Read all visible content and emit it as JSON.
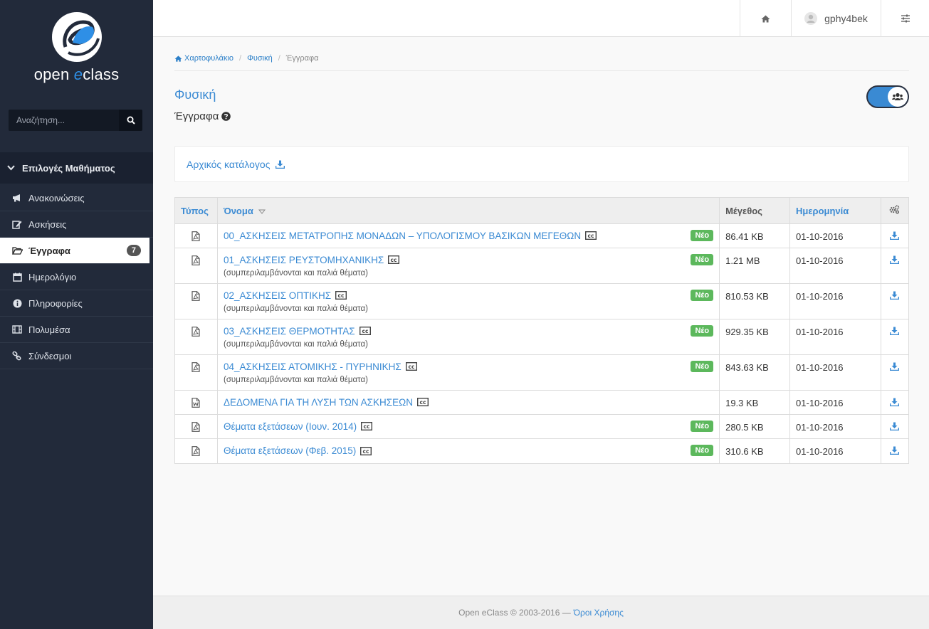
{
  "sidebar": {
    "logo": {
      "word1": "open ",
      "word2": "e",
      "word3": "class"
    },
    "search": {
      "placeholder": "Αναζήτηση..."
    },
    "menu_header": "Επιλογές Μαθήματος",
    "items": [
      {
        "label": "Ανακοινώσεις",
        "icon": "megaphone-icon"
      },
      {
        "label": "Ασκήσεις",
        "icon": "edit-icon"
      },
      {
        "label": "Έγγραφα",
        "icon": "folder-open-icon",
        "badge": "7",
        "active": true
      },
      {
        "label": "Ημερολόγιο",
        "icon": "calendar-icon"
      },
      {
        "label": "Πληροφορίες",
        "icon": "info-icon"
      },
      {
        "label": "Πολυμέσα",
        "icon": "film-icon"
      },
      {
        "label": "Σύνδεσμοι",
        "icon": "link-icon"
      }
    ]
  },
  "topbar": {
    "username": "gphy4bek"
  },
  "breadcrumb": [
    "Χαρτοφυλάκιο",
    "Φυσική",
    "Έγγραφα"
  ],
  "course_title": "Φυσική",
  "section_title": "Έγγραφα",
  "root_dir": "Αρχικός κατάλογος",
  "table": {
    "headers": {
      "type": "Τύπος",
      "name": "Όνομα",
      "size": "Μέγεθος",
      "date": "Ημερομηνία"
    },
    "new_label": "Νέο",
    "rows": [
      {
        "type": "pdf",
        "name": "00_ΑΣΚΗΣΕΙΣ ΜΕΤΑΤΡΟΠΗΣ ΜΟΝΑΔΩΝ – ΥΠΟΛΟΓΙΣΜΟΥ ΒΑΣΙΚΩΝ ΜΕΓΕΘΩΝ",
        "sub": "",
        "new": true,
        "size": "86.41 KB",
        "date": "01-10-2016"
      },
      {
        "type": "pdf",
        "name": "01_ΑΣΚΗΣΕΙΣ ΡΕΥΣΤΟΜΗΧΑΝΙΚΗΣ",
        "sub": "(συμπεριλαμβάνονται και παλιά θέματα)",
        "new": true,
        "size": "1.21 MB",
        "date": "01-10-2016"
      },
      {
        "type": "pdf",
        "name": "02_ΑΣΚΗΣΕΙΣ ΟΠΤΙΚΗΣ",
        "sub": "(συμπεριλαμβάνονται και παλιά θέματα)",
        "new": true,
        "size": "810.53 KB",
        "date": "01-10-2016"
      },
      {
        "type": "pdf",
        "name": "03_ΑΣΚΗΣΕΙΣ ΘΕΡΜΟΤΗΤΑΣ",
        "sub": "(συμπεριλαμβάνονται και παλιά θέματα)",
        "new": true,
        "size": "929.35 KB",
        "date": "01-10-2016"
      },
      {
        "type": "pdf",
        "name": "04_ΑΣΚΗΣΕΙΣ ΑΤΟΜΙΚΗΣ - ΠΥΡΗΝΙΚΗΣ",
        "sub": "(συμπεριλαμβάνονται και παλιά θέματα)",
        "new": true,
        "size": "843.63 KB",
        "date": "01-10-2016"
      },
      {
        "type": "word",
        "name": "ΔΕΔΟΜΕΝΑ ΓΙΑ ΤΗ ΛΥΣΗ ΤΩΝ ΑΣΚΗΣΕΩΝ",
        "sub": "",
        "new": false,
        "size": "19.3 KB",
        "date": "01-10-2016"
      },
      {
        "type": "pdf",
        "name": "Θέματα εξετάσεων (Ιουν. 2014)",
        "sub": "",
        "new": true,
        "size": "280.5 KB",
        "date": "01-10-2016"
      },
      {
        "type": "pdf",
        "name": "Θέματα εξετάσεων (Φεβ. 2015)",
        "sub": "",
        "new": true,
        "size": "310.6 KB",
        "date": "01-10-2016"
      }
    ]
  },
  "footer": {
    "text": "Open eClass © 2003-2016 — ",
    "link": "Όροι Χρήσης"
  },
  "colors": {
    "accent": "#3a8ad3",
    "sidebar": "#222a3a",
    "new_badge": "#5cb85c"
  }
}
